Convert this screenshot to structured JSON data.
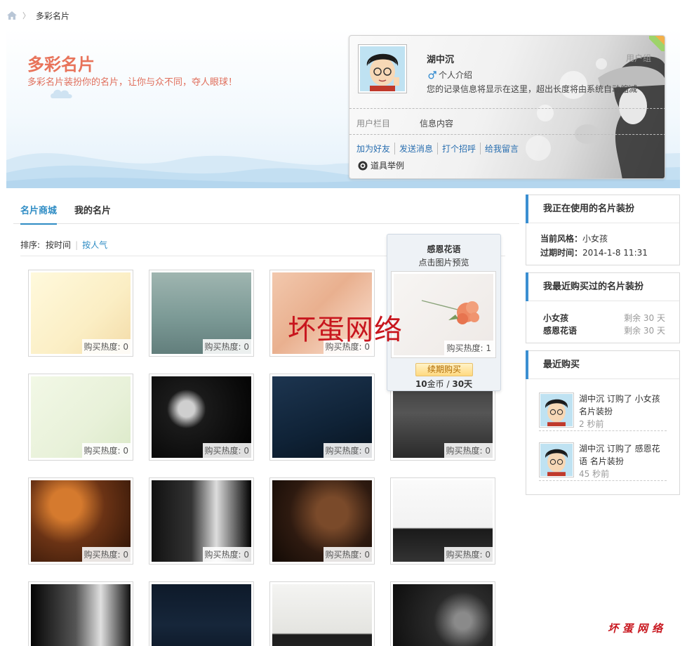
{
  "breadcrumb": {
    "home": "home-icon",
    "separator": "〉",
    "current": "多彩名片"
  },
  "banner": {
    "title": "多彩名片",
    "subtitle": "多彩名片装扮你的名片，让你与众不同，夺人眼球！"
  },
  "card": {
    "name": "湖中沉",
    "group": "用户组",
    "intro_label": "个人介绍",
    "description": "您的记录信息将显示在这里，超出长度将由系统自动缩减",
    "field_label": "用户栏目",
    "field_value": "信息内容",
    "actions": [
      "加为好友",
      "发送消息",
      "打个招呼",
      "给我留言"
    ],
    "tool_label": "道具举例"
  },
  "tabs": [
    {
      "label": "名片商城",
      "active": true
    },
    {
      "label": "我的名片",
      "active": false
    }
  ],
  "sort": {
    "label": "排序:",
    "options": [
      "按时间",
      "按人气"
    ],
    "active": "按时间"
  },
  "heat_label": "购买热度:",
  "cards": [
    {
      "heat": "0",
      "theme": "cartoon-warm"
    },
    {
      "heat": "0",
      "theme": "anime-teal"
    },
    {
      "heat": "0",
      "theme": "portrait-peach"
    },
    {
      "heat": "1",
      "theme": "flower-white"
    },
    {
      "heat": "0",
      "theme": "angel-green"
    },
    {
      "heat": "0",
      "theme": "swans-night"
    },
    {
      "heat": "0",
      "theme": "heroes-navy"
    },
    {
      "heat": "0",
      "theme": "girl-gray"
    },
    {
      "heat": "0",
      "theme": "fire-orange"
    },
    {
      "heat": "0",
      "theme": "smoke-bw"
    },
    {
      "heat": "0",
      "theme": "battle-brown"
    },
    {
      "heat": "0",
      "theme": "silhouette-white"
    },
    {
      "heat": "",
      "theme": "smoke2-bw"
    },
    {
      "heat": "",
      "theme": "avengers-dark"
    },
    {
      "heat": "",
      "theme": "soldiers-pale"
    },
    {
      "heat": "",
      "theme": "vintage-dark"
    }
  ],
  "popup": {
    "title": "感恩花语",
    "hint": "点击图片预览",
    "heat": "1",
    "renew_button": "续期购买",
    "price_amount": "10",
    "price_unit": "金币",
    "price_sep": " / ",
    "duration": "30天"
  },
  "watermark": {
    "main": "坏蛋网络",
    "corner": "坏蛋网络"
  },
  "sidebar": {
    "current": {
      "title": "我正在使用的名片装扮",
      "style_label": "当前风格：",
      "style_value": "小女孩",
      "expire_label": "过期时间：",
      "expire_value": "2014-1-8 11:31"
    },
    "recent_bought": {
      "title": "我最近购买过的名片装扮",
      "items": [
        {
          "name": "小女孩",
          "left": "剩余 30 天"
        },
        {
          "name": "感恩花语",
          "left": "剩余 30 天"
        }
      ]
    },
    "latest": {
      "title": "最近购买",
      "items": [
        {
          "text": "湖中沉 订购了 小女孩 名片装扮",
          "time": "2 秒前"
        },
        {
          "text": "湖中沉 订购了 感恩花语 名片装扮",
          "time": "45 秒前"
        }
      ]
    }
  },
  "colors": {
    "accent": "#2e8cc4",
    "banner_title": "#e8735a",
    "watermark": "#c8161e",
    "sidebar_bar": "#3b8fd1"
  }
}
